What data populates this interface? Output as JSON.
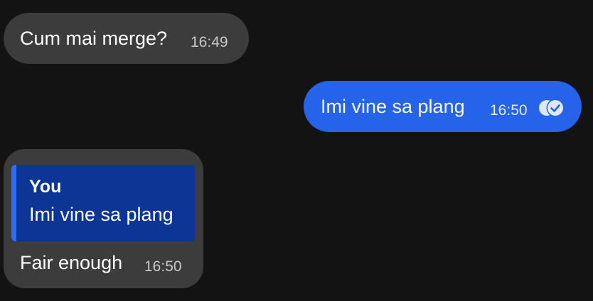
{
  "messages": [
    {
      "text": "Cum mai merge?",
      "time": "16:49",
      "direction": "incoming"
    },
    {
      "text": "Imi vine sa plang",
      "time": "16:50",
      "direction": "outgoing",
      "status_icon": "double-check-read-icon"
    },
    {
      "text": "Fair enough",
      "time": "16:50",
      "direction": "incoming",
      "reply_to": {
        "author": "You",
        "text": "Imi vine sa plang"
      }
    }
  ],
  "colors": {
    "background": "#131313",
    "incoming_bubble": "#3c3c3c",
    "outgoing_bubble": "#2563eb",
    "quote_background": "#0c3596",
    "quote_accent": "#2f6bff"
  }
}
